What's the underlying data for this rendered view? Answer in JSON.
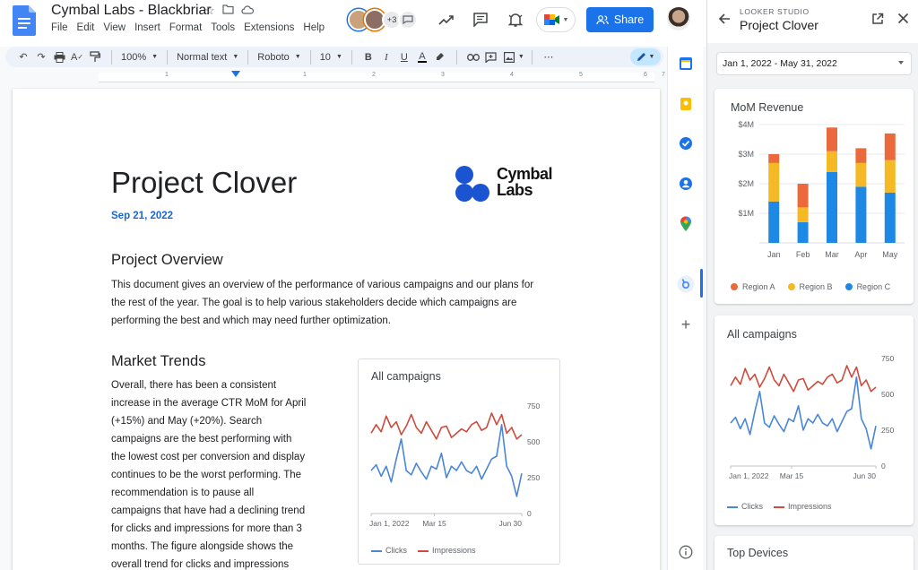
{
  "app": {
    "title": "Cymbal Labs - Blackbriar",
    "menu": [
      "File",
      "Edit",
      "View",
      "Insert",
      "Format",
      "Tools",
      "Extensions",
      "Help"
    ],
    "collaborator_count": "+3",
    "share_label": "Share"
  },
  "toolbar": {
    "zoom": "100%",
    "style": "Normal text",
    "font": "Roboto",
    "size": "10"
  },
  "ruler": [
    "1",
    "1",
    "2",
    "3",
    "4",
    "5",
    "6",
    "7"
  ],
  "doc": {
    "title": "Project Clover",
    "date": "Sep 21, 2022",
    "brand_line1": "Cymbal",
    "brand_line2": "Labs",
    "section1_heading": "Project Overview",
    "section1_lines": [
      "This document gives an overview of the performance of various campaigns and our plans for",
      "the rest of the year. The goal is to help various stakeholders decide which campaigns are",
      "performing the best and which may need further optimization."
    ],
    "section2_heading": "Market Trends",
    "section2_lines": [
      "Overall, there has been a consistent",
      "increase in the average CTR MoM for April",
      "(+15%) and May (+20%). Search",
      "campaigns are the best performing with",
      "the lowest cost per conversion and display",
      "continues to be the worst performing. The",
      "recommendation is to pause all",
      "campaigns that have had a declining trend",
      "for clicks and impressions for more than 3",
      "months. The figure alongside shows the",
      "overall trend for clicks and impressions"
    ]
  },
  "panel": {
    "subtitle": "LOOKER STUDIO",
    "title": "Project Clover",
    "date_range": "Jan 1, 2022 - May 31, 2022",
    "top_devices": "Top Devices"
  },
  "colors": {
    "accent": "#1a73e8",
    "region_a": "#ea6a3c",
    "region_b": "#f4b924",
    "region_c": "#1e88e5",
    "clicks": "#4a86d6",
    "impressions": "#cc4b3c"
  },
  "chart_data": [
    {
      "type": "bar",
      "title": "MoM Revenue",
      "categories": [
        "Jan",
        "Feb",
        "Mar",
        "Apr",
        "May"
      ],
      "series": [
        {
          "name": "Region A",
          "values": [
            0.3,
            0.8,
            0.8,
            0.5,
            0.9
          ]
        },
        {
          "name": "Region B",
          "values": [
            1.3,
            0.5,
            0.7,
            0.8,
            1.1
          ]
        },
        {
          "name": "Region C",
          "values": [
            1.4,
            0.7,
            2.4,
            1.9,
            1.7
          ]
        }
      ],
      "yticks": [
        "$1M",
        "$2M",
        "$3M",
        "$4M"
      ],
      "ylim": [
        0,
        4
      ],
      "stacked": true,
      "legend": "bottom"
    },
    {
      "type": "line",
      "title": "All campaigns",
      "xticks": [
        "Jan 1, 2022",
        "Mar 15",
        "Jun 30"
      ],
      "yticks": [
        "0",
        "250",
        "500",
        "750"
      ],
      "ylim": [
        0,
        750
      ],
      "series": [
        {
          "name": "Clicks",
          "values": [
            300,
            340,
            260,
            330,
            220,
            380,
            520,
            300,
            270,
            350,
            290,
            240,
            330,
            310,
            420,
            250,
            330,
            300,
            360,
            300,
            280,
            330,
            240,
            310,
            380,
            400,
            620,
            330,
            260,
            120,
            280
          ]
        },
        {
          "name": "Impressions",
          "values": [
            560,
            620,
            570,
            680,
            600,
            640,
            550,
            610,
            690,
            600,
            560,
            640,
            580,
            520,
            600,
            610,
            530,
            560,
            590,
            570,
            620,
            640,
            580,
            600,
            700,
            620,
            690,
            560,
            600,
            520,
            550
          ]
        }
      ],
      "legend": "bottom"
    }
  ]
}
